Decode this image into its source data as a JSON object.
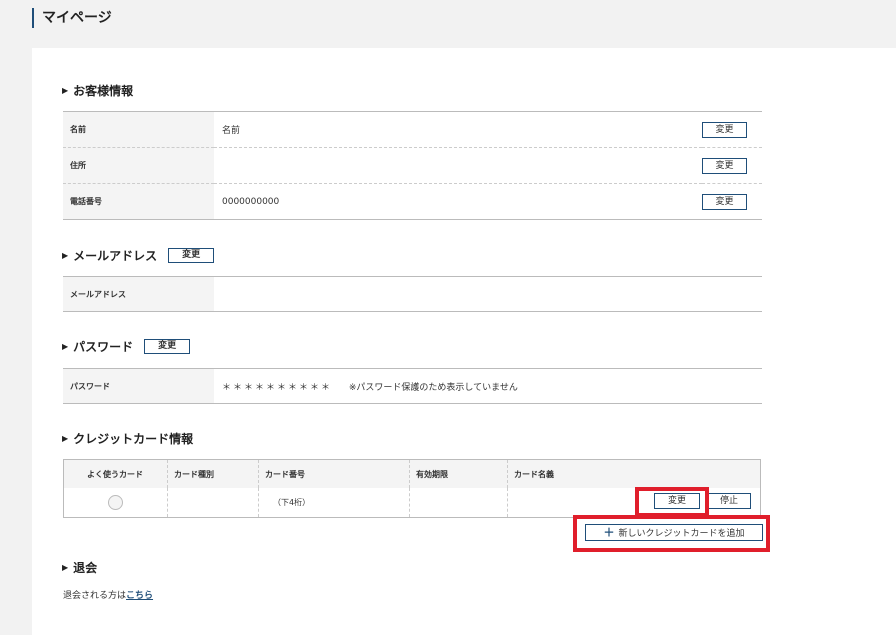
{
  "page": {
    "title": "マイページ"
  },
  "customer": {
    "heading": "お客様情報",
    "rows": [
      {
        "label": "名前",
        "value": "名前",
        "button": "変更"
      },
      {
        "label": "住所",
        "value": "",
        "button": "変更"
      },
      {
        "label": "電話番号",
        "value": "0000000000",
        "button": "変更"
      }
    ]
  },
  "email": {
    "heading": "メールアドレス",
    "button": "変更",
    "row": {
      "label": "メールアドレス",
      "value": ""
    }
  },
  "password": {
    "heading": "パスワード",
    "button": "変更",
    "row": {
      "label": "パスワード",
      "value": "＊＊＊＊＊＊＊＊＊＊",
      "note": "※パスワード保護のため表示していません"
    }
  },
  "credit_card": {
    "heading": "クレジットカード情報",
    "columns": [
      "よく使うカード",
      "カード種別",
      "カード番号",
      "有効期限",
      "カード名義"
    ],
    "row": {
      "type": "",
      "number": "（下4桁）",
      "expiry": "",
      "holder": "",
      "change_button": "変更",
      "stop_button": "停止"
    },
    "add_button": "新しいクレジットカードを追加"
  },
  "withdrawal": {
    "heading": "退会",
    "text": "退会される方は",
    "link": "こちら"
  }
}
